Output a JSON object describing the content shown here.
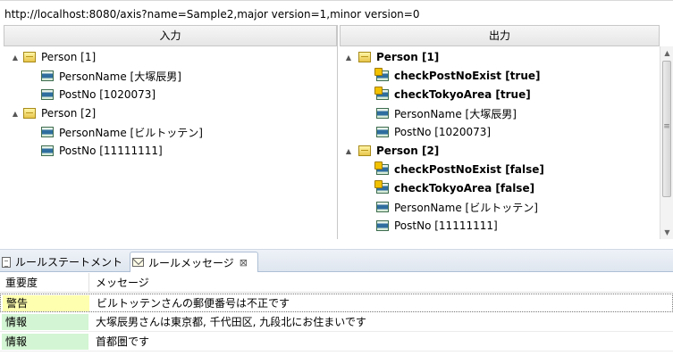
{
  "url": "http://localhost:8080/axis?name=Sample2,major version=1,minor version=0",
  "colors": {
    "warning_bg": "#ffffb0",
    "info_bg": "#d3f5d3",
    "header_bg": "#ececec"
  },
  "input_panel": {
    "header": "入力",
    "nodes": [
      {
        "label": "Person [1]",
        "icon": "object-icon",
        "expander": "▲"
      },
      {
        "label": "PersonName [大塚辰男]",
        "icon": "field-icon"
      },
      {
        "label": "PostNo [1020073]",
        "icon": "field-icon"
      },
      {
        "label": "Person [2]",
        "icon": "object-icon",
        "expander": "▲"
      },
      {
        "label": "PersonName [ビルトッテン]",
        "icon": "field-icon"
      },
      {
        "label": "PostNo [11111111]",
        "icon": "field-icon"
      }
    ]
  },
  "output_panel": {
    "header": "出力",
    "nodes": [
      {
        "label": "Person [1]",
        "icon": "object-icon",
        "expander": "▲"
      },
      {
        "label": "checkPostNoExist [true]",
        "icon": "check-field-icon"
      },
      {
        "label": "checkTokyoArea [true]",
        "icon": "check-field-icon"
      },
      {
        "label": "PersonName [大塚辰男]",
        "icon": "field-icon"
      },
      {
        "label": "PostNo [1020073]",
        "icon": "field-icon"
      },
      {
        "label": "Person [2]",
        "icon": "object-icon",
        "expander": "▲"
      },
      {
        "label": "checkPostNoExist [false]",
        "icon": "check-field-icon"
      },
      {
        "label": "checkTokyoArea [false]",
        "icon": "check-field-icon"
      },
      {
        "label": "PersonName [ビルトッテン]",
        "icon": "field-icon"
      },
      {
        "label": "PostNo [11111111]",
        "icon": "field-icon"
      }
    ]
  },
  "tabs": [
    {
      "label": "ルールステートメント",
      "icon": "document-icon"
    },
    {
      "label": "ルールメッセージ",
      "icon": "mail-icon",
      "close": "⊠"
    }
  ],
  "messages": {
    "columns": [
      "重要度",
      "メッセージ"
    ],
    "rows": [
      {
        "severity": "警告",
        "message": "ビルトッテンさんの郵便番号は不正です"
      },
      {
        "severity": "情報",
        "message": "大塚辰男さんは東京都, 千代田区, 九段北にお住まいです"
      },
      {
        "severity": "情報",
        "message": "首都圏です"
      }
    ]
  }
}
